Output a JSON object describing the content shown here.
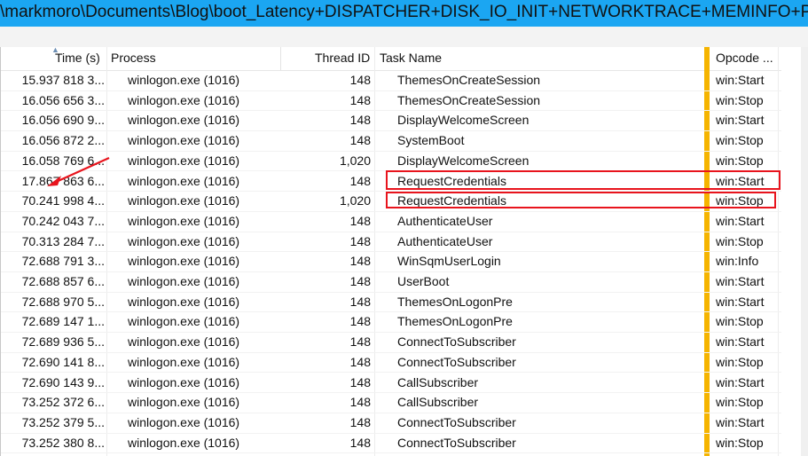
{
  "window": {
    "title": "\\markmoro\\Documents\\Blog\\boot_Latency+DISPATCHER+DISK_IO_INIT+NETWORKTRACE+MEMINFO+POWER+PE"
  },
  "table": {
    "columns": {
      "time": "Time (s)",
      "process": "Process",
      "thread": "Thread ID",
      "task": "Task Name",
      "opcode": "Opcode ..."
    },
    "rows": [
      {
        "time": "15.937 818 3...",
        "process": "winlogon.exe (1016)",
        "thread": "148",
        "task": "ThemesOnCreateSession",
        "opcode": "win:Start"
      },
      {
        "time": "16.056 656 3...",
        "process": "winlogon.exe (1016)",
        "thread": "148",
        "task": "ThemesOnCreateSession",
        "opcode": "win:Stop"
      },
      {
        "time": "16.056 690 9...",
        "process": "winlogon.exe (1016)",
        "thread": "148",
        "task": "DisplayWelcomeScreen",
        "opcode": "win:Start"
      },
      {
        "time": "16.056 872 2...",
        "process": "winlogon.exe (1016)",
        "thread": "148",
        "task": "SystemBoot",
        "opcode": "win:Stop"
      },
      {
        "time": "16.058 769 6...",
        "process": "winlogon.exe (1016)",
        "thread": "1,020",
        "task": "DisplayWelcomeScreen",
        "opcode": "win:Stop"
      },
      {
        "time": "17.867 863 6...",
        "process": "winlogon.exe (1016)",
        "thread": "148",
        "task": "RequestCredentials",
        "opcode": "win:Start"
      },
      {
        "time": "70.241 998 4...",
        "process": "winlogon.exe (1016)",
        "thread": "1,020",
        "task": "RequestCredentials",
        "opcode": "win:Stop"
      },
      {
        "time": "70.242 043 7...",
        "process": "winlogon.exe (1016)",
        "thread": "148",
        "task": "AuthenticateUser",
        "opcode": "win:Start"
      },
      {
        "time": "70.313 284 7...",
        "process": "winlogon.exe (1016)",
        "thread": "148",
        "task": "AuthenticateUser",
        "opcode": "win:Stop"
      },
      {
        "time": "72.688 791 3...",
        "process": "winlogon.exe (1016)",
        "thread": "148",
        "task": "WinSqmUserLogin",
        "opcode": "win:Info"
      },
      {
        "time": "72.688 857 6...",
        "process": "winlogon.exe (1016)",
        "thread": "148",
        "task": "UserBoot",
        "opcode": "win:Start"
      },
      {
        "time": "72.688 970 5...",
        "process": "winlogon.exe (1016)",
        "thread": "148",
        "task": "ThemesOnLogonPre",
        "opcode": "win:Start"
      },
      {
        "time": "72.689 147 1...",
        "process": "winlogon.exe (1016)",
        "thread": "148",
        "task": "ThemesOnLogonPre",
        "opcode": "win:Stop"
      },
      {
        "time": "72.689 936 5...",
        "process": "winlogon.exe (1016)",
        "thread": "148",
        "task": "ConnectToSubscriber",
        "opcode": "win:Start"
      },
      {
        "time": "72.690 141 8...",
        "process": "winlogon.exe (1016)",
        "thread": "148",
        "task": "ConnectToSubscriber",
        "opcode": "win:Stop"
      },
      {
        "time": "72.690 143 9...",
        "process": "winlogon.exe (1016)",
        "thread": "148",
        "task": "CallSubscriber",
        "opcode": "win:Start"
      },
      {
        "time": "73.252 372 6...",
        "process": "winlogon.exe (1016)",
        "thread": "148",
        "task": "CallSubscriber",
        "opcode": "win:Stop"
      },
      {
        "time": "73.252 379 5...",
        "process": "winlogon.exe (1016)",
        "thread": "148",
        "task": "ConnectToSubscriber",
        "opcode": "win:Start"
      },
      {
        "time": "73.252 380 8...",
        "process": "winlogon.exe (1016)",
        "thread": "148",
        "task": "ConnectToSubscriber",
        "opcode": "win:Stop"
      }
    ]
  },
  "colors": {
    "titlebar": "#1ba6f2",
    "opcode_bar": "#f5b400",
    "annotation": "#e8141d"
  }
}
